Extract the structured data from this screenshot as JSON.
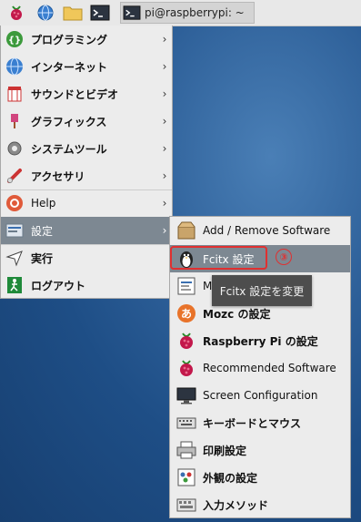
{
  "taskbar": {
    "terminal_title": "pi@raspberrypi: ~"
  },
  "menu": {
    "items": [
      {
        "label": "プログラミング",
        "icon": "programming-icon"
      },
      {
        "label": "インターネット",
        "icon": "internet-icon"
      },
      {
        "label": "サウンドとビデオ",
        "icon": "sound-video-icon"
      },
      {
        "label": "グラフィックス",
        "icon": "graphics-icon"
      },
      {
        "label": "システムツール",
        "icon": "system-tools-icon"
      },
      {
        "label": "アクセサリ",
        "icon": "accessories-icon"
      },
      {
        "label": "Help",
        "icon": "help-icon"
      },
      {
        "label": "設定",
        "icon": "preferences-icon"
      },
      {
        "label": "実行",
        "icon": "run-icon"
      },
      {
        "label": "ログアウト",
        "icon": "logout-icon"
      }
    ]
  },
  "submenu": {
    "items": [
      {
        "label": "Add / Remove Software"
      },
      {
        "label": "Fcitx 設定"
      },
      {
        "label": "M"
      },
      {
        "label": "Mozc の設定"
      },
      {
        "label": "Raspberry Pi の設定"
      },
      {
        "label": "Recommended Software"
      },
      {
        "label": "Screen Configuration"
      },
      {
        "label": "キーボードとマウス"
      },
      {
        "label": "印刷設定"
      },
      {
        "label": "外観の設定"
      },
      {
        "label": "入力メソッド"
      }
    ]
  },
  "annotation": {
    "step": "③",
    "tooltip": "Fcitx 設定を変更"
  },
  "colors": {
    "menu_bg": "#ececec",
    "active_bg": "#7d8892",
    "highlight": "#e03030",
    "desktop": "#2d5f98"
  }
}
